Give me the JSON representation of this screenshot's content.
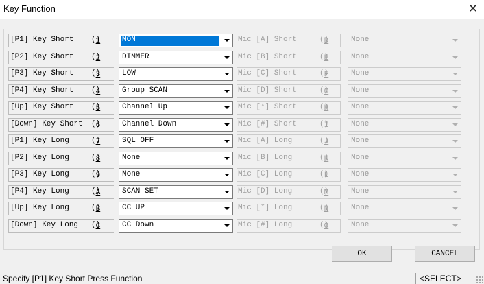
{
  "window": {
    "title": "Key Function",
    "close_glyph": "✕"
  },
  "rows": [
    {
      "label": "[P1] Key Short",
      "key": "1",
      "function": "MON",
      "mic_label": "Mic [A] Short",
      "mic_key": "D",
      "mic_function": "None"
    },
    {
      "label": "[P2] Key Short",
      "key": "2",
      "function": "DIMMER",
      "mic_label": "Mic [B] Short",
      "mic_key": "E",
      "mic_function": "None"
    },
    {
      "label": "[P3] Key Short",
      "key": "3",
      "function": "LOW",
      "mic_label": "Mic [C] Short",
      "mic_key": "F",
      "mic_function": "None"
    },
    {
      "label": "[P4] Key Short",
      "key": "4",
      "function": "Group SCAN",
      "mic_label": "Mic [D] Short",
      "mic_key": "G",
      "mic_function": "None"
    },
    {
      "label": "[Up] Key Short",
      "key": "5",
      "function": "Channel Up",
      "mic_label": "Mic [*] Short",
      "mic_key": "H",
      "mic_function": "None"
    },
    {
      "label": "[Down] Key Short",
      "key": "6",
      "function": "Channel Down",
      "mic_label": "Mic [#] Short",
      "mic_key": "I",
      "mic_function": "None"
    },
    {
      "label": "[P1] Key Long",
      "key": "7",
      "function": "SQL OFF",
      "mic_label": "Mic [A] Long",
      "mic_key": "J",
      "mic_function": "None"
    },
    {
      "label": "[P2] Key Long",
      "key": "8",
      "function": "None",
      "mic_label": "Mic [B] Long",
      "mic_key": "K",
      "mic_function": "None"
    },
    {
      "label": "[P3] Key Long",
      "key": "9",
      "function": "None",
      "mic_label": "Mic [C] Long",
      "mic_key": "L",
      "mic_function": "None"
    },
    {
      "label": "[P4] Key Long",
      "key": "A",
      "function": "SCAN SET",
      "mic_label": "Mic [D] Long",
      "mic_key": "M",
      "mic_function": "None"
    },
    {
      "label": "[Up] Key Long",
      "key": "B",
      "function": "CC UP",
      "mic_label": "Mic [*] Long",
      "mic_key": "N",
      "mic_function": "None"
    },
    {
      "label": "[Down] Key Long",
      "key": "C",
      "function": "CC Down",
      "mic_label": "Mic [#] Long",
      "mic_key": "O",
      "mic_function": "None"
    }
  ],
  "selected_row": 0,
  "buttons": {
    "ok": "OK",
    "cancel": "CANCEL"
  },
  "status": {
    "message": "Specify [P1] Key Short Press Function",
    "mode": "<SELECT>"
  },
  "colors": {
    "highlight": "#0078d7",
    "disabled_text": "#a0a0a0"
  }
}
